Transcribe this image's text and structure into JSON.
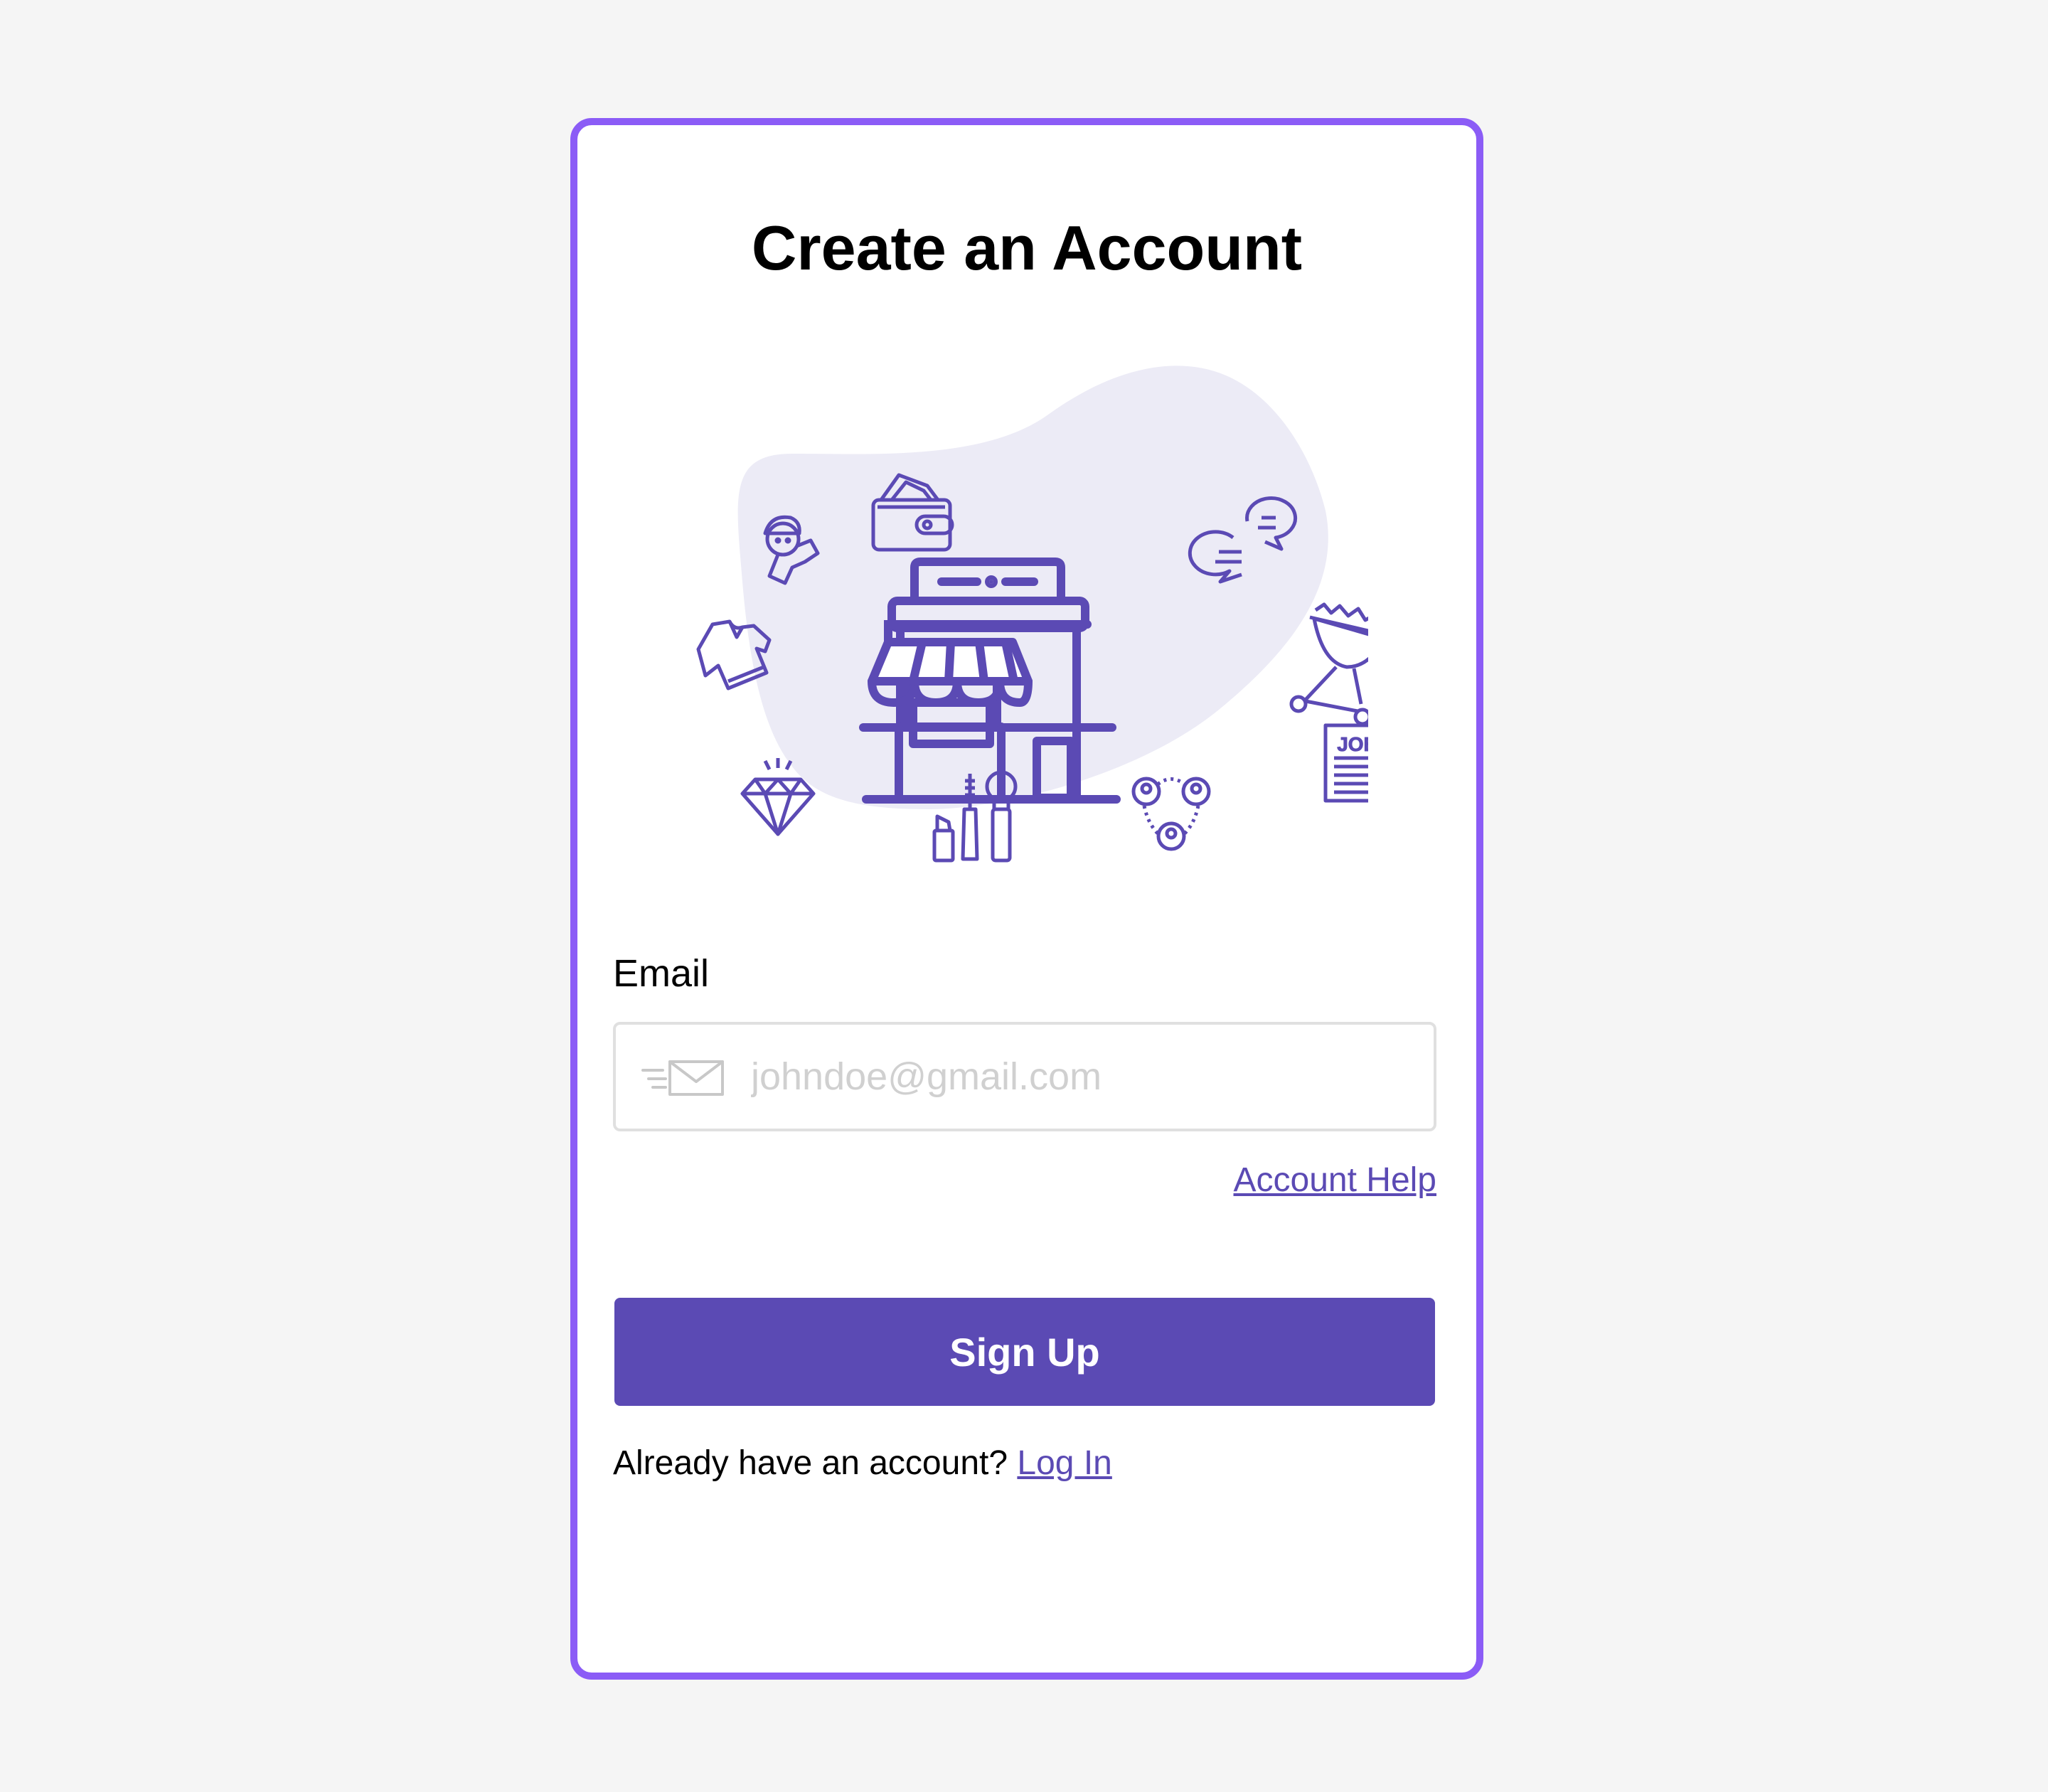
{
  "title": "Create an Account",
  "illustration": {
    "icons": [
      "storefront-icon",
      "wallet-icon",
      "person-icon",
      "chat-bubbles-icon",
      "tshirt-icon",
      "grill-icon",
      "job-document-icon",
      "diamond-icon",
      "cosmetics-icon",
      "network-icon"
    ],
    "job_text": "JOB"
  },
  "form": {
    "email_label": "Email",
    "email_value": "",
    "email_placeholder": "johndoe@gmail.com",
    "help_link": "Account Help",
    "submit_label": "Sign Up"
  },
  "footer": {
    "prompt": "Already have an account?",
    "login_link": "Log In"
  },
  "colors": {
    "card_border": "#8b5cf6",
    "accent": "#5b4ab4",
    "blob": "#ecebf6",
    "page_bg": "#f5f5f5"
  }
}
